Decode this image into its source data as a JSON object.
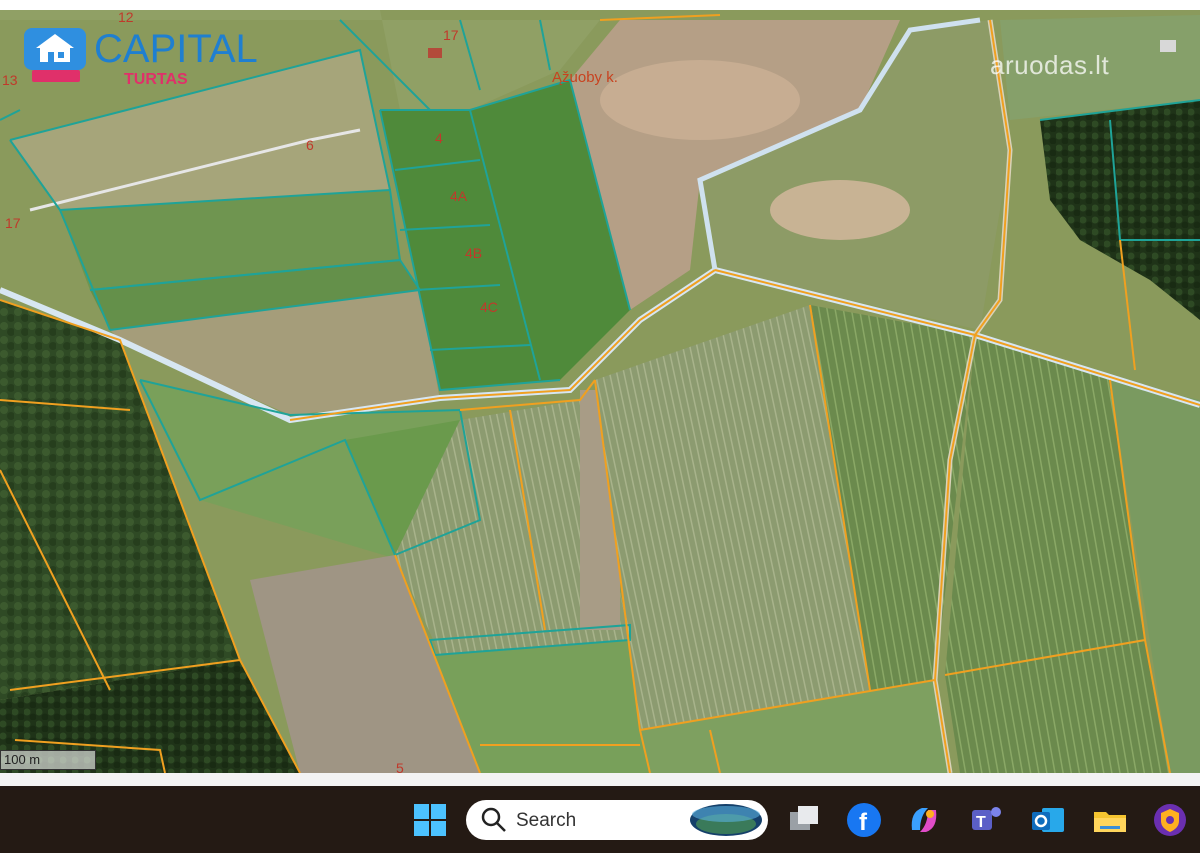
{
  "map": {
    "labels": {
      "village": "Ąžuoby k.",
      "plot_4": "4",
      "plot_4a": "4A",
      "plot_4b": "4B",
      "plot_4c": "4C",
      "plot_6": "6",
      "plot_17_top": "17",
      "plot_17_left": "17",
      "plot_12": "12",
      "plot_13": "13",
      "plot_5": "5"
    },
    "scale_bar": "100 m",
    "colors": {
      "cadastral_teal": "#1fa398",
      "cadastral_orange": "#f0a020",
      "road_light": "#b9d8ef",
      "field_green": "#5f8a45",
      "field_light": "#9aa06a",
      "forest_dark": "#2c4a22",
      "bare_soil": "#a49784"
    }
  },
  "logo": {
    "brand": "CAPITAL",
    "sub": "TURTAS",
    "brand_color": "#1f7fd0",
    "sub_color": "#e0306a"
  },
  "watermark": {
    "text": "aruodas.lt"
  },
  "taskbar": {
    "search_label": "Search",
    "icons": [
      "windows-start-icon",
      "search-icon",
      "task-view-icon",
      "facebook-icon",
      "copilot-icon",
      "teams-icon",
      "outlook-icon",
      "file-explorer-icon",
      "vpn-shield-icon"
    ]
  }
}
